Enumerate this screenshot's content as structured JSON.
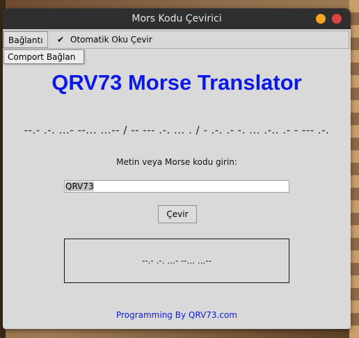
{
  "window": {
    "title": "Mors Kodu Çevirici"
  },
  "menu": {
    "connection": "Bağlantı",
    "check_mark": "✔",
    "auto_read": "Otomatik Oku Çevir"
  },
  "dropdown": {
    "item": "Comport Bağlan"
  },
  "heading": "QRV73 Morse Translator",
  "morse_display": "--.- .-. ...- --... ...-- / -- --- .-. ... . / - .-. .- -. ... .-.. .- - --- .-.",
  "prompt": "Metin veya Morse kodu girin:",
  "input": {
    "value": "QRV73"
  },
  "convert_button": "Çevir",
  "output": "--.- .-. ...- --... ...--",
  "footer": "Programming By QRV73.com",
  "colors": {
    "accent": "#0a19e6",
    "titlebar": "#2f2f2f",
    "window_bg": "#d9d9d9",
    "close": "#e0443e",
    "minimize": "#f5a623"
  }
}
